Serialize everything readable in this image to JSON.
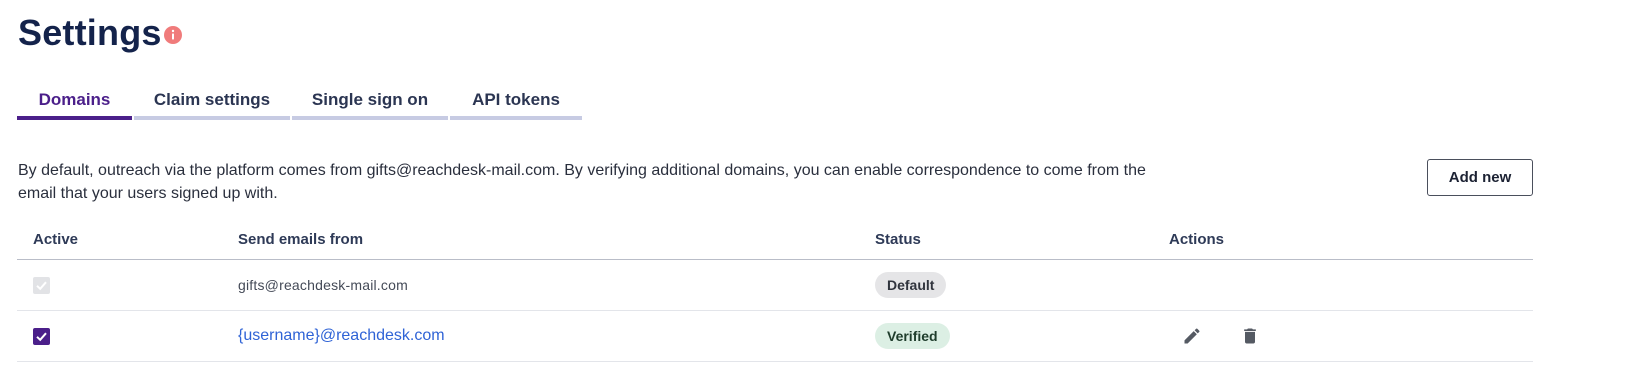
{
  "page": {
    "title": "Settings",
    "info_icon": "info-icon",
    "accent_color": "#4b1f8a",
    "info_color": "#f07b7b"
  },
  "tabs": [
    {
      "label": "Domains",
      "active": true
    },
    {
      "label": "Claim settings",
      "active": false
    },
    {
      "label": "Single sign on",
      "active": false
    },
    {
      "label": "API tokens",
      "active": false
    }
  ],
  "description": "By default, outreach via the platform comes from gifts@reachdesk-mail.com. By verifying additional domains, you can enable correspondence to come from the email that your users signed up with.",
  "add_button_label": "Add new",
  "table": {
    "columns": [
      "Active",
      "Send emails from",
      "Status",
      "Actions"
    ],
    "rows": [
      {
        "active": true,
        "active_disabled": true,
        "email": "gifts@reachdesk-mail.com",
        "status": "Default",
        "actions": []
      },
      {
        "active": true,
        "active_disabled": false,
        "email": "{username}@reachdesk.com",
        "status": "Verified",
        "actions": [
          "pencil-icon",
          "trash-icon"
        ]
      }
    ]
  }
}
